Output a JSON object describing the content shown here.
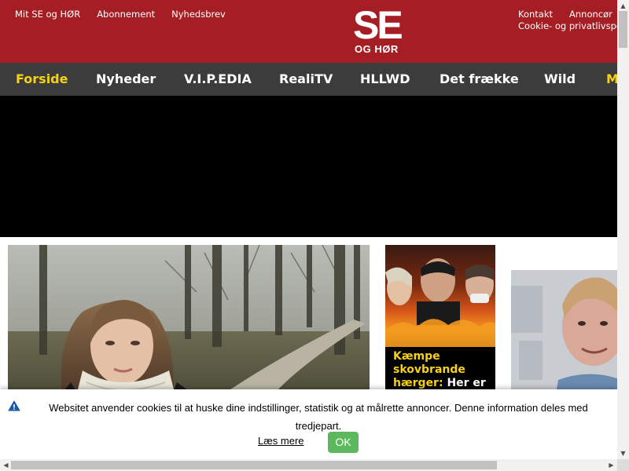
{
  "header": {
    "links_left": [
      "Mit SE og HØR",
      "Abonnement",
      "Nyhedsbrev"
    ],
    "logo_big": "SE",
    "logo_small": "OG HØR",
    "links_right_row1": [
      "Kontakt",
      "Annoncør"
    ],
    "links_right_row2": "Cookie- og privatlivspolitik",
    "brand_color": "#a41e23"
  },
  "nav": {
    "items": [
      "Forside",
      "Nyheder",
      "V.I.P.EDIA",
      "RealiTV",
      "HLLWD",
      "Det frække",
      "Wild",
      "M"
    ],
    "active_index": 0,
    "active_color": "#f6d214",
    "bg_color": "#3c3c3c"
  },
  "teaser": {
    "caption_yellow": "Kæmpe skovbrande hærger:",
    "caption_white": "Her er"
  },
  "cookie": {
    "icon": "warning-icon",
    "message": "Websitet anvender cookies til at huske dine indstillinger, statistik og at målrette annoncer. Denne information deles med tredjepart.",
    "more_label": "Læs mere",
    "ok_label": "OK",
    "ok_color": "#5cb85c"
  }
}
